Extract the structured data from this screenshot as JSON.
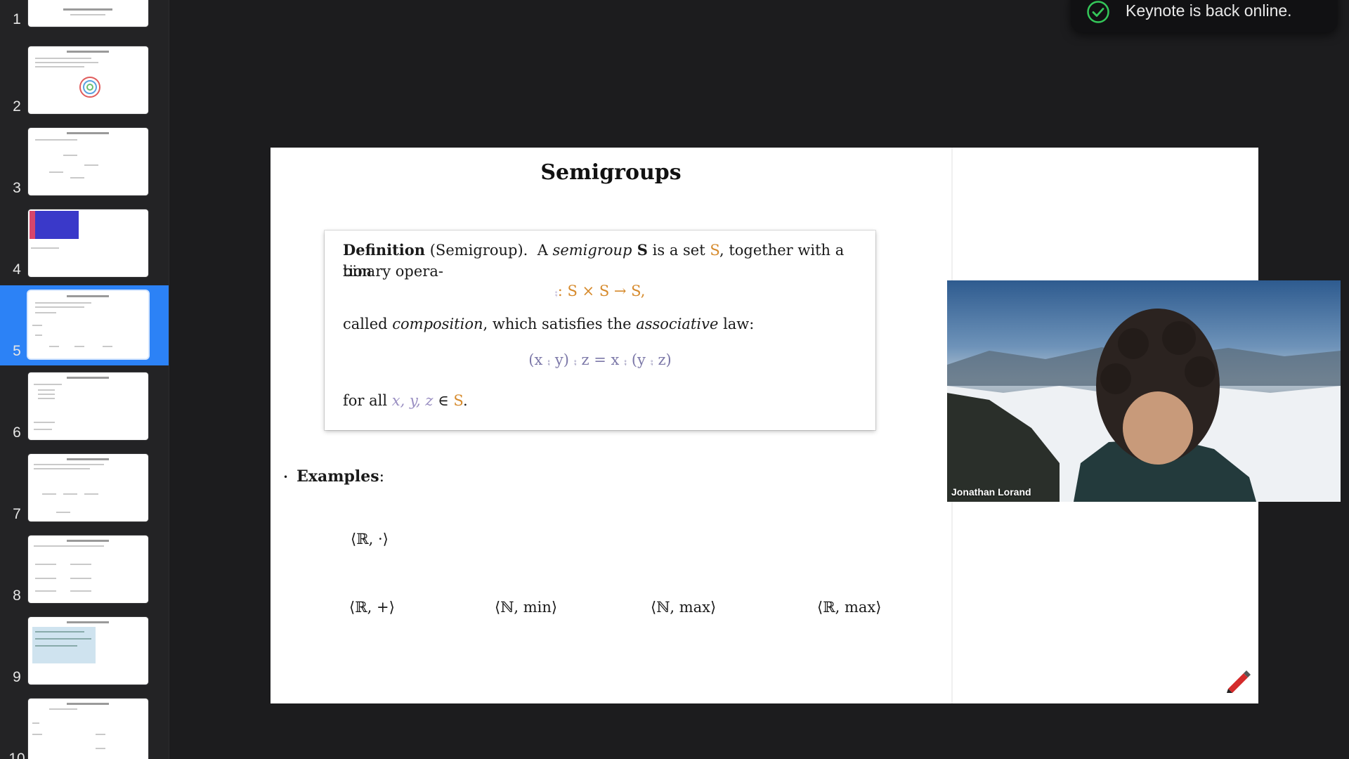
{
  "sidebar": {
    "selected": "5",
    "slides": [
      {
        "number": "1"
      },
      {
        "number": "2"
      },
      {
        "number": "3"
      },
      {
        "number": "4"
      },
      {
        "number": "5"
      },
      {
        "number": "6"
      },
      {
        "number": "7"
      },
      {
        "number": "8"
      },
      {
        "number": "9"
      },
      {
        "number": "10"
      }
    ]
  },
  "slide": {
    "title": "Semigroups",
    "definition": {
      "label": "Definition",
      "paren": "(Semigroup).",
      "line1_a": "A ",
      "term": "semigroup",
      "line1_b": " S",
      "line1_c": " is a set ",
      "set_symbol": "S",
      "line1_d": ", together with a binary opera-",
      "line2": "tion",
      "op_symbol": "⨾",
      "op_sig": ": S × S → S,",
      "line3_a": "called ",
      "composition": "composition",
      "line3_b": ", which satisfies the ",
      "associative": "associative",
      "line3_c": " law:",
      "law": "(x ⨾ y) ⨾ z = x ⨾ (y ⨾ z)",
      "forall_a": "for all ",
      "forall_vars": "x, y, z",
      "forall_b": " ∈ ",
      "forall_set": "S",
      "forall_c": "."
    },
    "examples_label": "Examples",
    "examples_colon": ":",
    "examples": {
      "row1": [
        "⟨ℝ, ·⟩"
      ],
      "row2": [
        "⟨ℝ, +⟩",
        "⟨ℕ, min⟩",
        "⟨ℕ, max⟩",
        "⟨ℝ, max⟩"
      ]
    }
  },
  "video": {
    "participant_name": "Jonathan Lorand"
  },
  "toast": {
    "message": "Keynote is back online."
  },
  "colors": {
    "accent": "#2c82f6",
    "set_orange": "#d68a2c",
    "op_lilac": "#9a8fc2"
  },
  "icons": {
    "toast": "check-circle-icon",
    "slide_corner": "pen-icon"
  }
}
